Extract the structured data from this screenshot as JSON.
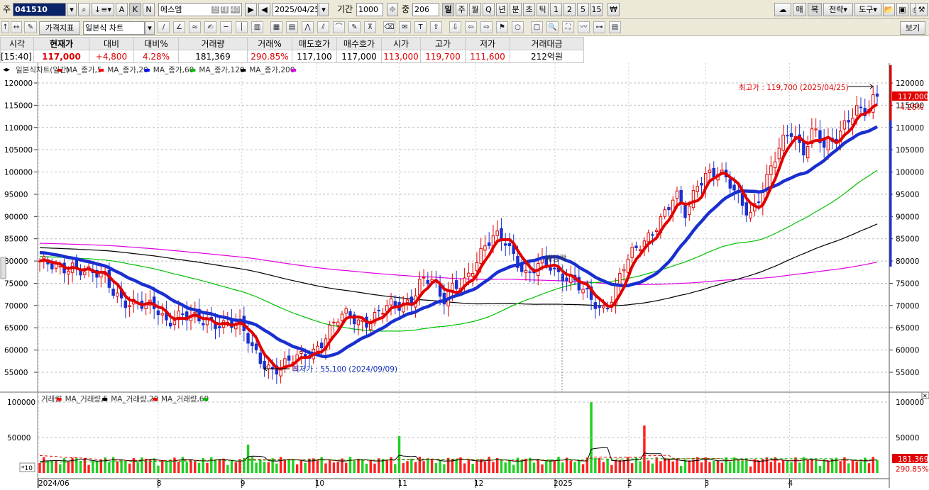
{
  "toolbar1": {
    "prefix": "주",
    "code": "041510",
    "name": "에스엠",
    "name_tags": [
      "신",
      "대",
      "40"
    ],
    "date": "2025/04/25",
    "period_label": "기간",
    "period": "1000",
    "count_label": "중",
    "count": "206",
    "letter_buttons": [
      "A",
      "K",
      "N"
    ],
    "tf_buttons": [
      "일",
      "주",
      "월",
      "Q",
      "년",
      "분",
      "초",
      "틱",
      "1",
      "2",
      "5",
      "15"
    ],
    "tf_active": "일",
    "right_buttons": [
      "매",
      "복",
      "전략",
      "도구"
    ]
  },
  "toolbar2": {
    "indicator": "가격지표",
    "chart_type": "일본식 차트",
    "view_label": "보기"
  },
  "quote": {
    "headers": [
      "시각",
      "현재가",
      "대비",
      "대비%",
      "거래량",
      "거래%",
      "매도호가",
      "매수호가",
      "시가",
      "고가",
      "저가",
      "거래대금"
    ],
    "values": [
      "[15:40]",
      "117,000",
      "+4,800",
      "4.28%",
      "181,369",
      "290.85%",
      "117,100",
      "117,000",
      "113,000",
      "119,700",
      "111,600",
      "212억원"
    ]
  },
  "legend": {
    "price": [
      {
        "name": "일본식차트(일간)",
        "color": "#c00000"
      },
      {
        "name": "MA_종가,5",
        "color": "#ff0000"
      },
      {
        "name": "MA_종가,20",
        "color": "#0000ff"
      },
      {
        "name": "MA_종가,60",
        "color": "#00c000"
      },
      {
        "name": "MA_종가,120",
        "color": "#000000"
      },
      {
        "name": "MA_종가,200",
        "color": "#e000e0"
      }
    ],
    "volume": [
      {
        "name": "거래량",
        "color": "#ff0000"
      },
      {
        "name": "MA_거래량,5",
        "color": "#000000"
      },
      {
        "name": "MA_거래량,20",
        "color": "#ff0000"
      },
      {
        "name": "MA_거래량,60",
        "color": "#00c000"
      }
    ]
  },
  "annotations": {
    "high": "최고가 : 119,700 (2025/04/25)",
    "low": "최저가 : 55,100 (2024/09/09)",
    "dividend": "배당락",
    "last_price": "117,000",
    "last_change": "4.28%",
    "last_volume": "181,369",
    "last_vol_pct": "290.85%",
    "vol_unit": "*10"
  },
  "chart_data": {
    "type": "candlestick",
    "ylim": [
      51000,
      123000
    ],
    "yticks": [
      55000,
      60000,
      65000,
      70000,
      75000,
      80000,
      85000,
      90000,
      95000,
      100000,
      105000,
      110000,
      115000,
      120000
    ],
    "x_labels": [
      "2024/06",
      "8",
      "9",
      "10",
      "11",
      "12",
      "2025",
      "2",
      "3",
      "4"
    ],
    "trading_days": 206,
    "key_points": [
      {
        "date": "2024/06",
        "close": 79000
      },
      {
        "date": "2024/07 end",
        "close": 67000
      },
      {
        "date": "2024/09/09",
        "low": 55100
      },
      {
        "date": "2024/10",
        "close": 66000
      },
      {
        "date": "2024/11 end",
        "close": 86000
      },
      {
        "date": "2024/12/27",
        "close": 73000
      },
      {
        "date": "2025/01",
        "close": 69000
      },
      {
        "date": "2025/02",
        "close": 88000
      },
      {
        "date": "2025/03",
        "close": 99000
      },
      {
        "date": "2025/04/25",
        "high": 119700,
        "close": 117000,
        "open": 113000,
        "low": 111600
      }
    ],
    "close_path": [
      80000,
      78500,
      77500,
      79500,
      78500,
      77000,
      76000,
      73000,
      71500,
      70500,
      69500,
      69000,
      66500,
      68500,
      67500,
      66000,
      66000,
      66500,
      66500,
      65000,
      60000,
      57500,
      56000,
      56500,
      57500,
      58500,
      60500,
      63500,
      66500,
      67500,
      66500,
      67000,
      68500,
      69500,
      69500,
      71500,
      76500,
      75500,
      70000,
      74500,
      76000,
      79000,
      82500,
      85500,
      85000,
      80500,
      76000,
      78500,
      79500,
      77500,
      76500,
      73500,
      71000,
      69000,
      72500,
      78500,
      81500,
      84000,
      88000,
      91500,
      94500,
      89500,
      97500,
      100500,
      100000,
      97000,
      93500,
      91000,
      95500,
      100500,
      106000,
      109500,
      105000,
      110000,
      105000,
      106500,
      111500,
      115000,
      113000,
      117000
    ],
    "volume": {
      "ylim": [
        0,
        105000
      ],
      "yticks": [
        50000,
        100000
      ],
      "spikes": [
        {
          "pos": 0.66,
          "value": 100000
        },
        {
          "pos": 0.72,
          "value": 67000
        },
        {
          "pos": 0.91,
          "value": 72000
        },
        {
          "pos": 0.43,
          "value": 52000
        },
        {
          "pos": 0.25,
          "value": 40000
        }
      ]
    }
  }
}
